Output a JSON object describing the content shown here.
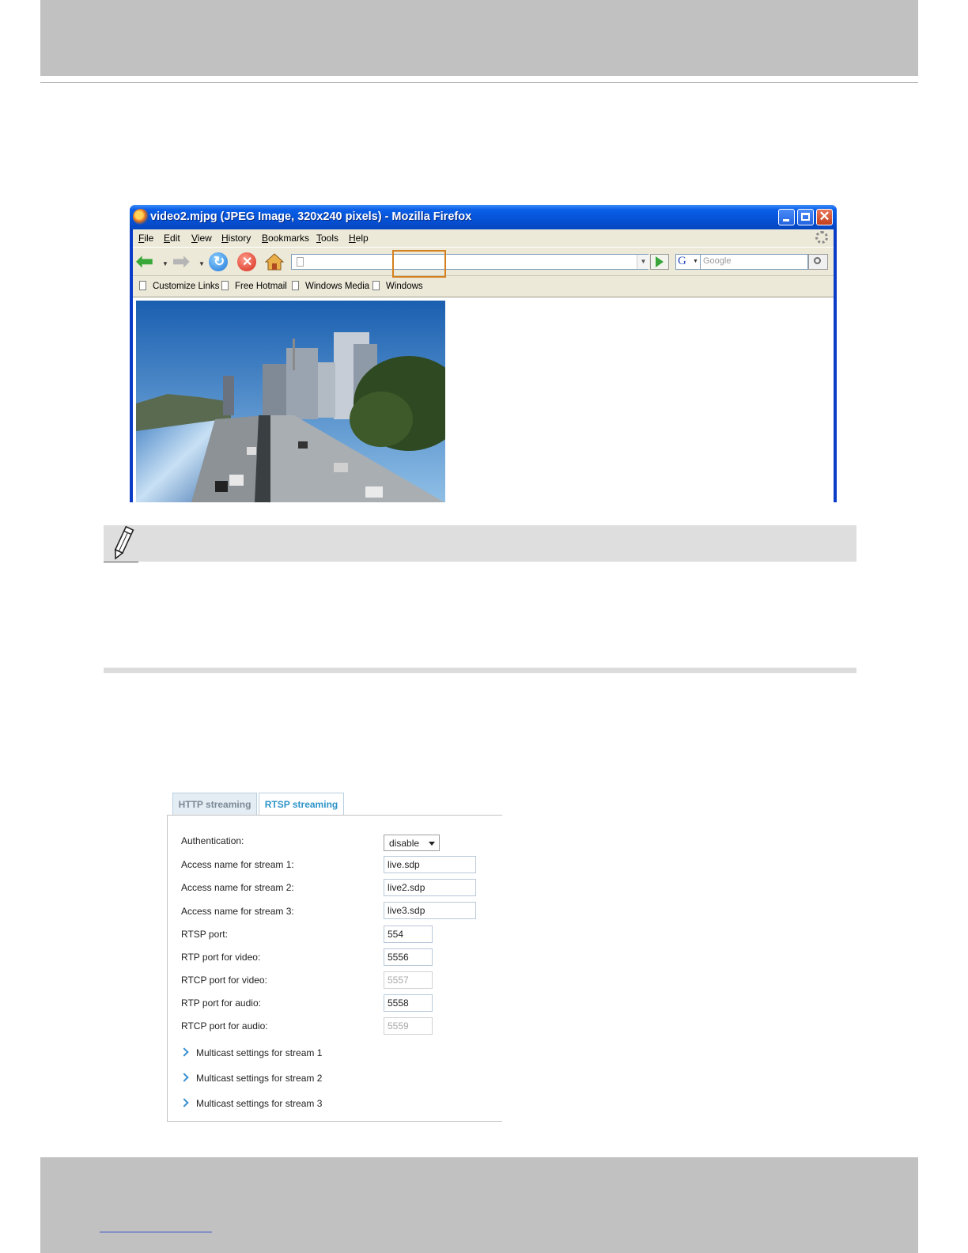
{
  "browser": {
    "title": "video2.mjpg (JPEG Image, 320x240 pixels) - Mozilla Firefox",
    "menu": [
      "File",
      "Edit",
      "View",
      "History",
      "Bookmarks",
      "Tools",
      "Help"
    ],
    "search_placeholder": "Google",
    "search_engine_glyph": "G",
    "bookmarks": [
      "Customize Links",
      "Free Hotmail",
      "Windows Media",
      "Windows"
    ]
  },
  "rtsp_settings": {
    "tabs": [
      "HTTP streaming",
      "RTSP streaming"
    ],
    "active_tab": "RTSP streaming",
    "labels": {
      "authentication": "Authentication:",
      "stream1": "Access name for stream 1:",
      "stream2": "Access name for stream 2:",
      "stream3": "Access name for stream 3:",
      "rtsp_port": "RTSP port:",
      "rtp_video": "RTP port for video:",
      "rtcp_video": "RTCP port for video:",
      "rtp_audio": "RTP port for audio:",
      "rtcp_audio": "RTCP port for audio:"
    },
    "values": {
      "authentication": "disable",
      "stream1": "live.sdp",
      "stream2": "live2.sdp",
      "stream3": "live3.sdp",
      "rtsp_port": "554",
      "rtp_video": "5556",
      "rtcp_video": "5557",
      "rtp_audio": "5558",
      "rtcp_audio": "5559"
    },
    "multicast_links": [
      "Multicast settings for stream 1",
      "Multicast settings for stream 2",
      "Multicast settings for stream 3"
    ]
  },
  "colors": {
    "highlight_box": "#d4801e",
    "active_tab_text": "#2e95c8",
    "titlebar_blue": "#0552d6"
  }
}
